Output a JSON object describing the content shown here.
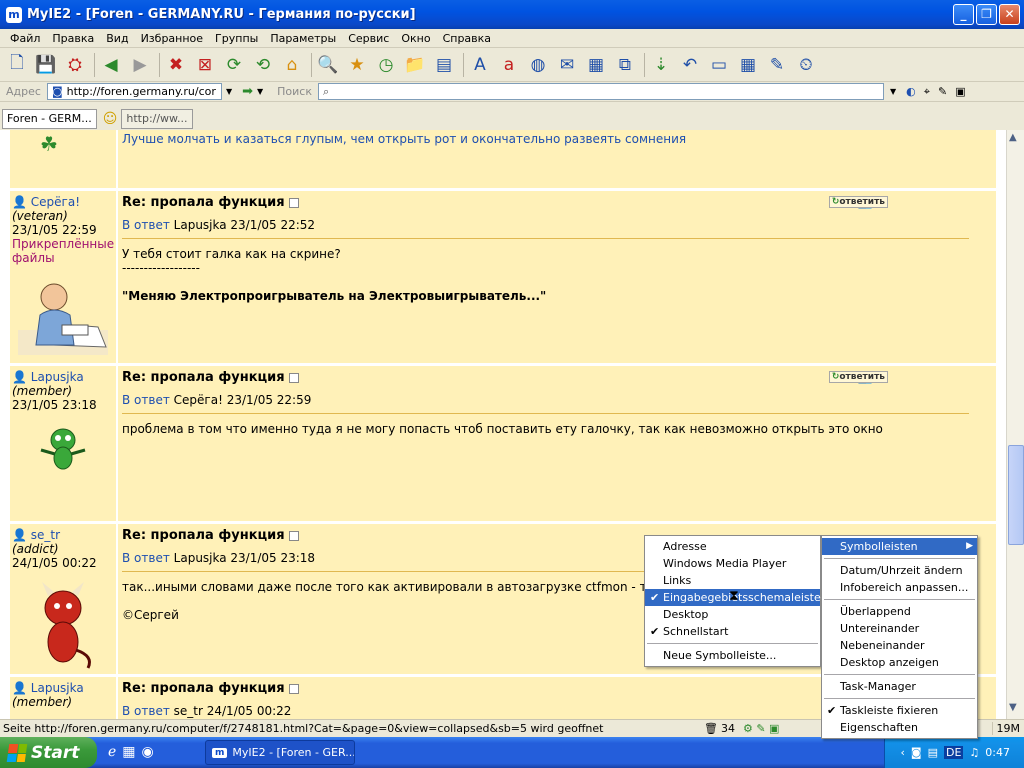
{
  "window": {
    "title": "MyIE2 - [Foren - GERMANY.RU - Германия по-русски]",
    "app_icon": "myie2-icon",
    "buttons": [
      "minimize-icon",
      "maximize-icon",
      "close-icon"
    ]
  },
  "menubar": {
    "items": [
      "Файл",
      "Правка",
      "Вид",
      "Избранное",
      "Группы",
      "Параметры",
      "Сервис",
      "Окно",
      "Справка"
    ]
  },
  "addressbar": {
    "address_label": "Адрес",
    "address_value": "http://foren.germany.ru/cor",
    "search_label": "Поиск",
    "search_value": ""
  },
  "tabs": [
    {
      "label": "Foren - GERM..."
    },
    {
      "label": "http://ww..."
    }
  ],
  "posts": [
    {
      "id": "post-0",
      "body_lines": [
        "Лучше молчать и казаться глупым, чем открыть рот и окончательно развеять сомнения"
      ]
    },
    {
      "id": "post-1",
      "username": "Серёга!",
      "role": "(veteran)",
      "date": "23/1/05 22:59",
      "files_label": "Прикреплённые файлы",
      "title": "Re: пропала функция",
      "reply_label": "В ответ",
      "reply_to": "Lapusjka 23/1/05 22:52",
      "answer_label": "ответить",
      "body_lines": [
        "У тебя стоит галка как на скрине?",
        "------------------"
      ],
      "signature": "\"Меняю Электропроигрыватель на Электровыигрыватель...\""
    },
    {
      "id": "post-2",
      "username": "Lapusjka",
      "role": "(member)",
      "date": "23/1/05 23:18",
      "title": "Re: пропала функция",
      "reply_label": "В ответ",
      "reply_to": "Серёга! 23/1/05 22:59",
      "answer_label": "ответить",
      "body_lines": [
        "проблема в том что именно туда я не могу попасть чтоб поставить ету галочку, так как невозможно открыть это окно"
      ]
    },
    {
      "id": "post-3",
      "username": "se_tr",
      "role": "(addict)",
      "date": "24/1/05 00:22",
      "title": "Re: пропала функция",
      "reply_label": "В ответ",
      "reply_to": "Lapusjka 23/1/05 23:18",
      "body_lines": [
        "так...иными словами даже после того как активировали в автозагрузке ctfmon - то кноп"
      ],
      "signature": "©Сергей"
    },
    {
      "id": "post-4",
      "username": "Lapusjka",
      "role": "(member)",
      "title": "Re: пропала функция",
      "reply_label": "В ответ",
      "reply_to": "se_tr 24/1/05 00:22"
    }
  ],
  "statusbar": {
    "text": "Seite http://foren.germany.ru/computer/f/2748181.html?Cat=&page=0&view=collapsed&sb=5 wird geoffnet",
    "count": "34",
    "memory": "19M"
  },
  "context_menu_left": {
    "items": [
      {
        "label": "Adresse",
        "checked": false
      },
      {
        "label": "Windows Media Player",
        "checked": false
      },
      {
        "label": "Links",
        "checked": false
      },
      {
        "label": "Eingabegebietsschemaleiste",
        "checked": true,
        "selected": true
      },
      {
        "label": "Desktop",
        "checked": false
      },
      {
        "label": "Schnellstart",
        "checked": true
      }
    ],
    "footer": "Neue Symbolleiste..."
  },
  "context_menu_right": {
    "group1": [
      {
        "label": "Symbolleisten",
        "submenu": true
      }
    ],
    "group2": [
      {
        "label": "Datum/Uhrzeit ändern"
      },
      {
        "label": "Infobereich anpassen..."
      }
    ],
    "group3": [
      {
        "label": "Überlappend"
      },
      {
        "label": "Untereinander"
      },
      {
        "label": "Nebeneinander"
      },
      {
        "label": "Desktop anzeigen"
      }
    ],
    "group4": [
      {
        "label": "Task-Manager"
      }
    ],
    "group5": [
      {
        "label": "Taskleiste fixieren",
        "checked": true
      },
      {
        "label": "Eigenschaften"
      }
    ]
  },
  "taskbar": {
    "start_label": "Start",
    "task_label": "MyIE2 - [Foren - GER...",
    "lang": "DE",
    "clock": "0:47"
  }
}
